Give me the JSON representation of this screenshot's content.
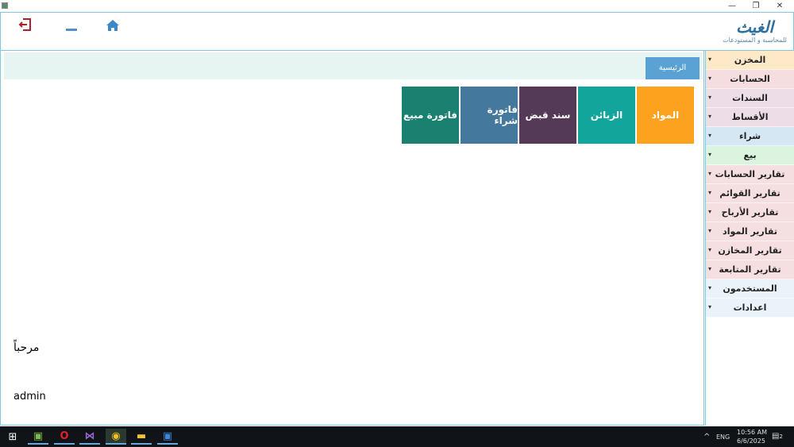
{
  "window": {
    "minimize": "—",
    "maximize": "❐",
    "close": "✕"
  },
  "header": {
    "logo_title": "الغيث",
    "logo_subtitle": "للمحاسبة و المستودعات"
  },
  "breadcrumb": {
    "home": "الرئيسية"
  },
  "tiles": [
    {
      "label": "المواد",
      "color": "#fca21f"
    },
    {
      "label": "الزبائن",
      "color": "#12a59c"
    },
    {
      "label": "سند قبض",
      "color": "#553a58"
    },
    {
      "label": "فاتورة شراء",
      "color": "#44789c"
    },
    {
      "label": "فاتورة مبيع",
      "color": "#1a8070"
    }
  ],
  "welcome": "مرحباً",
  "username": "admin",
  "sidebar": {
    "items": [
      {
        "label": "المخزن",
        "color": "#fde8c8"
      },
      {
        "label": "الحسابات",
        "color": "#f6dde0"
      },
      {
        "label": "السندات",
        "color": "#ecdde6"
      },
      {
        "label": "الأقساط",
        "color": "#ecdde6"
      },
      {
        "label": "شراء",
        "color": "#d6e7f4"
      },
      {
        "label": "بيع",
        "color": "#dbf4df"
      },
      {
        "label": "تقارير الحسابات",
        "color": "#f6dfe0"
      },
      {
        "label": "تقارير القوائم",
        "color": "#f6dfe0"
      },
      {
        "label": "تقارير الأرباح",
        "color": "#f6dfe0"
      },
      {
        "label": "تقارير المواد",
        "color": "#f6dfe0"
      },
      {
        "label": "تقارير المخازن",
        "color": "#f6dfe0"
      },
      {
        "label": "تقارير المتابعة",
        "color": "#f6dfe0"
      },
      {
        "label": "المستخدمون",
        "color": "#eaf3fa"
      },
      {
        "label": "اعدادات",
        "color": "#eaf3fa"
      }
    ]
  },
  "taskbar": {
    "lang": "ENG",
    "time": "10:56 AM",
    "date": "6/6/2025",
    "notifications": "2"
  }
}
